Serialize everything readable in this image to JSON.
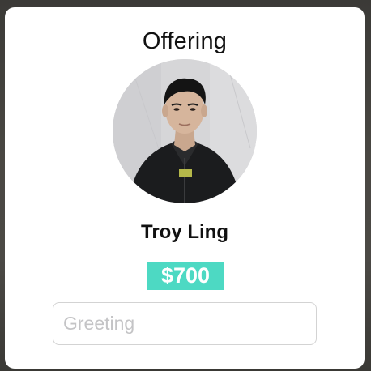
{
  "dialog": {
    "title": "Offering",
    "profile": {
      "name": "Troy Ling",
      "photo": "profile-photo"
    },
    "price": "$700",
    "greeting": {
      "placeholder": "Greeting",
      "value": ""
    }
  },
  "colors": {
    "price_badge": "#4dd9c3",
    "background": "#ffffff",
    "input_border": "#d3d3d3",
    "placeholder": "#c4c4c6"
  }
}
